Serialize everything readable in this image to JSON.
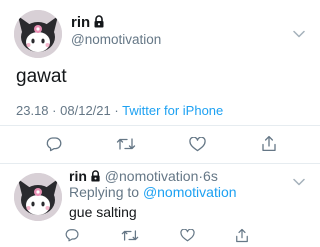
{
  "main_tweet": {
    "name": "rin",
    "handle": "@nomotivation",
    "text": "gawat",
    "time": "23.18",
    "date": "08/12/21",
    "separator": "·",
    "source": "Twitter for iPhone"
  },
  "reply_tweet": {
    "name": "rin",
    "handle": "@nomotivation",
    "separator": "·",
    "age": "6s",
    "replying_prefix": "Replying to",
    "replying_handle": "@nomotivation",
    "text": "gue salting"
  },
  "icons": {
    "avatar": "kuromi-avatar",
    "lock": "lock-icon",
    "menu": "chevron-down-icon",
    "reply": "reply-icon",
    "retweet": "retweet-icon",
    "like": "heart-icon",
    "share": "share-icon"
  },
  "colors": {
    "text": "#14171a",
    "secondary": "#657786",
    "link": "#1da1f2",
    "divider": "#e6ecf0"
  }
}
